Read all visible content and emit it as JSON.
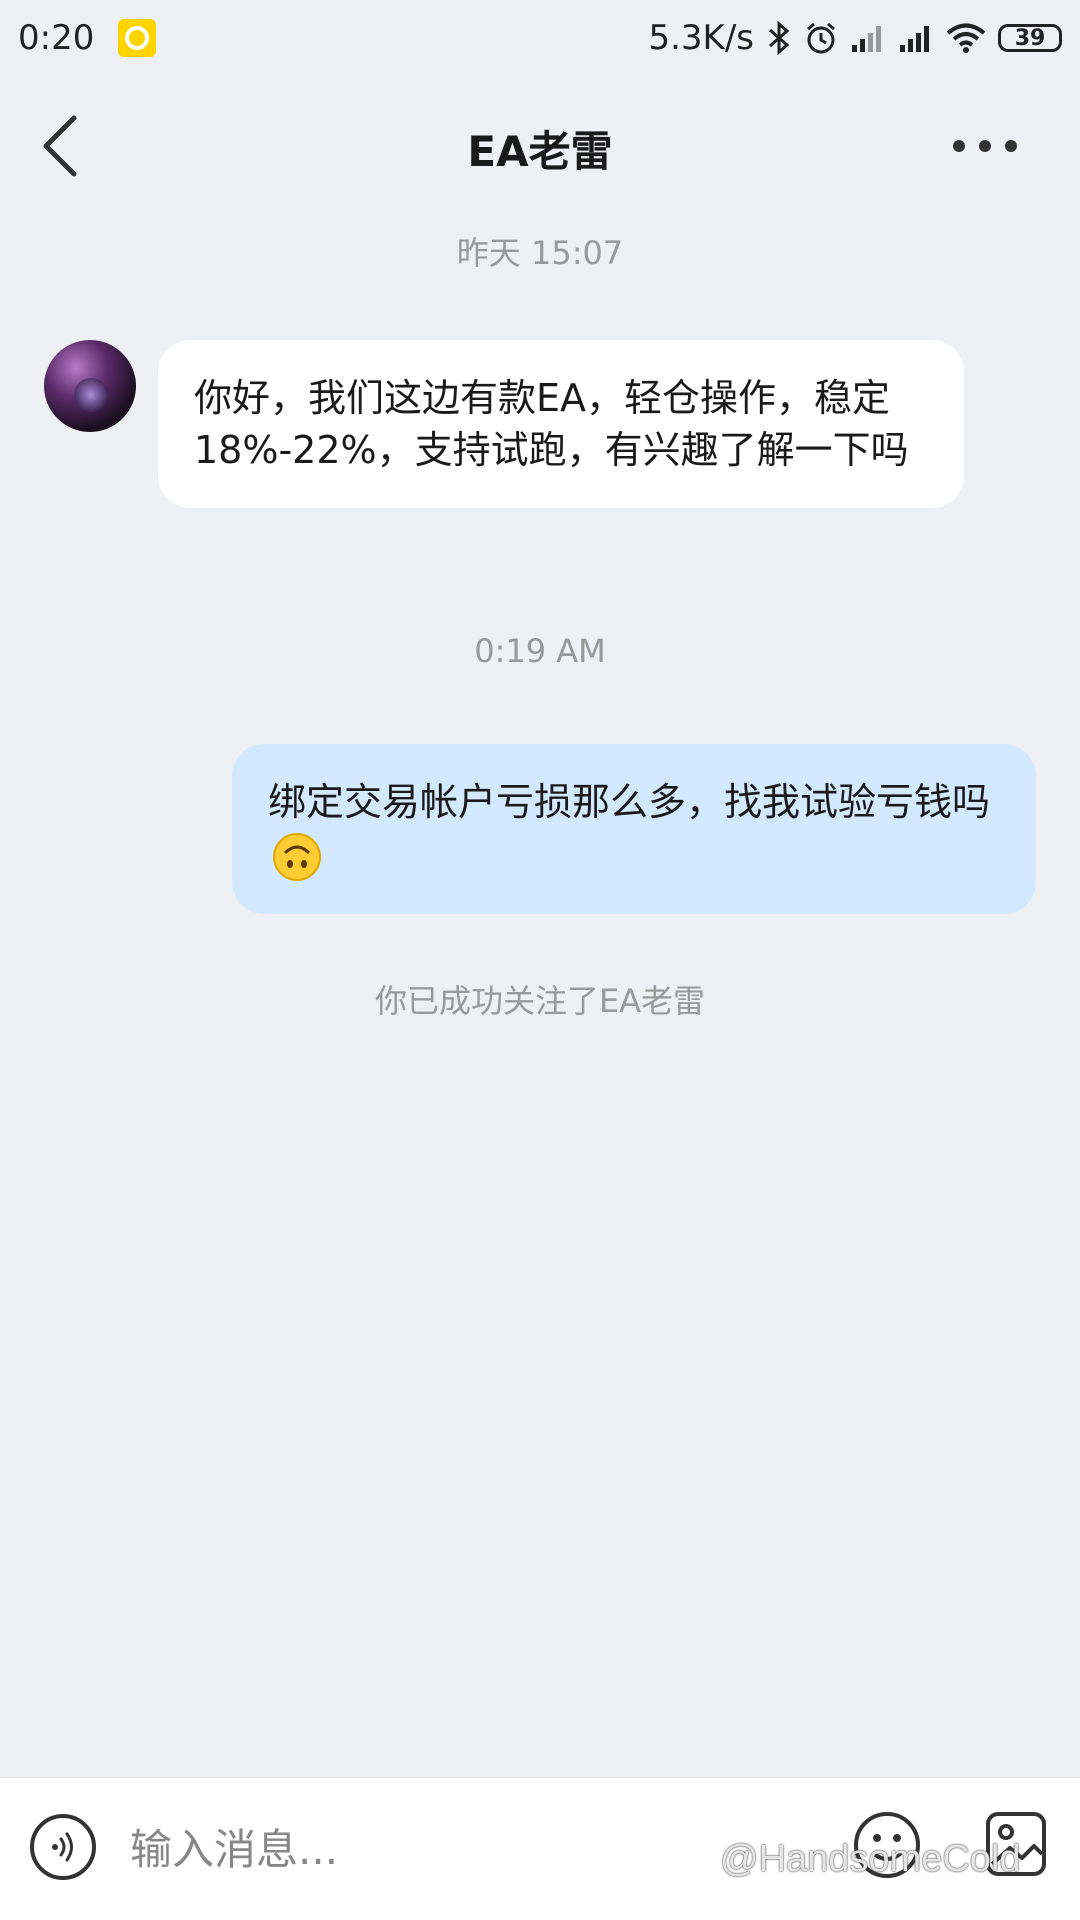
{
  "status_bar": {
    "time": "0:20",
    "net_speed": "5.3K/s",
    "battery": "39"
  },
  "header": {
    "title": "EA老雷"
  },
  "timestamps": {
    "first": "昨天 15:07",
    "second": "0:19 AM"
  },
  "messages": [
    {
      "direction": "incoming",
      "text": "你好，我们这边有款EA，轻仓操作，稳定18%-22%，支持试跑，有兴趣了解一下吗"
    },
    {
      "direction": "outgoing",
      "text": "绑定交易帐户亏损那么多，找我试验亏钱吗",
      "emoji": "upside-down-face"
    }
  ],
  "system_note": "你已成功关注了EA老雷",
  "input": {
    "placeholder": "输入消息..."
  },
  "watermark": "@HandsomeCold",
  "colors": {
    "background": "#eef0f3",
    "incoming_bubble": "#ffffff",
    "outgoing_bubble": "#d3e9ff",
    "muted_text": "#999999"
  }
}
